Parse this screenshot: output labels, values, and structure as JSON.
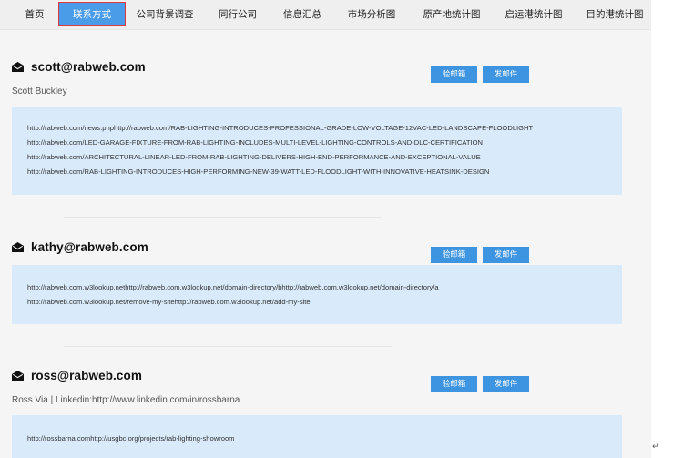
{
  "nav": {
    "tabs": [
      {
        "label": "首页"
      },
      {
        "label": "联系方式",
        "active": true
      },
      {
        "label": "公司背景调查"
      },
      {
        "label": "同行公司"
      },
      {
        "label": "信息汇总"
      },
      {
        "label": "市场分析图"
      },
      {
        "label": "原产地统计图"
      },
      {
        "label": "启运港统计图"
      },
      {
        "label": "目的港统计图"
      }
    ]
  },
  "contacts": [
    {
      "email": "scott@rabweb.com",
      "subline": "Scott Buckley",
      "verify_label": "验邮箱",
      "send_label": "发邮件",
      "urls": [
        "http://rabweb.com/news.phphttp://rabweb.com/RAB-LIGHTING-INTRODUCES-PROFESSIONAL-GRADE-LOW-VOLTAGE-12VAC-LED-LANDSCAPE-FLOODLIGHT",
        "http://rabweb.com/LED-GARAGE-FIXTURE-FROM-RAB-LIGHTING-INCLUDES-MULTI-LEVEL-LIGHTING-CONTROLS-AND-DLC-CERTIFICATION",
        "http://rabweb.com/ARCHITECTURAL-LINEAR-LED-FROM-RAB-LIGHTING-DELIVERS-HIGH-END-PERFORMANCE-AND-EXCEPTIONAL-VALUE",
        "http://rabweb.com/RAB-LIGHTING-INTRODUCES-HIGH-PERFORMING-NEW-39-WATT-LED-FLOODLIGHT-WITH-INNOVATIVE-HEATSINK-DESIGN"
      ]
    },
    {
      "email": "kathy@rabweb.com",
      "subline": "",
      "verify_label": "验邮箱",
      "send_label": "发邮件",
      "urls": [
        "http://rabweb.com.w3lookup.nethttp://rabweb.com.w3lookup.net/domain-directory/bhttp://rabweb.com.w3lookup.net/domain-directory/a",
        "http://rabweb.com.w3lookup.net/remove-my-sitehttp://rabweb.com.w3lookup.net/add-my-site"
      ]
    },
    {
      "email": "ross@rabweb.com",
      "subline": "Ross Via | Linkedin:http://www.linkedin.com/in/rossbarna",
      "verify_label": "验邮箱",
      "send_label": "发邮件",
      "urls": [
        "http://rossbarna.comhttp://usgbc.org/projects/rab-lighting-showroom"
      ]
    }
  ],
  "colors": {
    "tab_active": "#4a9be8",
    "button": "#3d94e0",
    "url_box": "#d9ebfa"
  }
}
